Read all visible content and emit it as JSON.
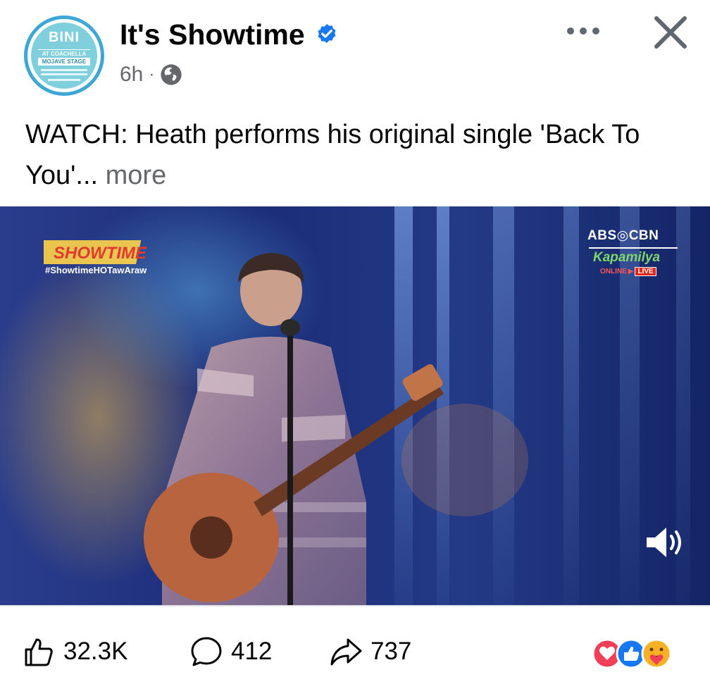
{
  "header": {
    "page_name": "It's Showtime",
    "time": "6h",
    "separator": "·",
    "avatar_text": {
      "brand": "BINI",
      "line1": "AT COACHELLA",
      "line2": "MOJAVE STAGE"
    }
  },
  "post": {
    "caption": "WATCH: Heath performs his original single 'Back To You'...",
    "more_label": "more"
  },
  "video": {
    "show_logo": "SHOWTIME",
    "hashtag": "#ShowtimeHOTawAraw",
    "network": "ABS◎CBN",
    "kapamilya": "Kapamilya",
    "online": "ONLINE",
    "live": "LIVE"
  },
  "engagement": {
    "likes": "32.3K",
    "comments": "412",
    "shares": "737"
  },
  "colors": {
    "brand_blue": "#1877f2",
    "muted_text": "#65676b",
    "love_red": "#f33e58"
  },
  "icons": {
    "verified": "verified-badge-icon",
    "globe": "globe-icon",
    "more": "more-dots-icon",
    "close": "close-icon",
    "volume": "volume-icon",
    "like": "like-icon",
    "comment": "comment-icon",
    "share": "share-icon"
  }
}
